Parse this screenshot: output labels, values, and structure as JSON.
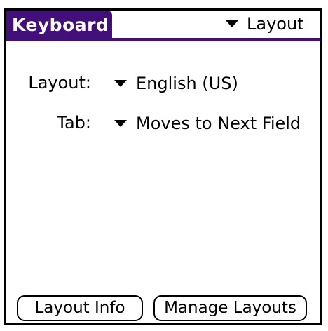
{
  "title": "Keyboard",
  "menu": {
    "label": "Layout",
    "icon": "triangle-down-icon"
  },
  "fields": [
    {
      "label": "Layout:",
      "value": "English (US)"
    },
    {
      "label": "Tab:",
      "value": "Moves to Next Field"
    }
  ],
  "buttons": {
    "layout_info": "Layout Info",
    "manage_layouts": "Manage Layouts"
  },
  "colors": {
    "title_bar": "#43107b"
  }
}
